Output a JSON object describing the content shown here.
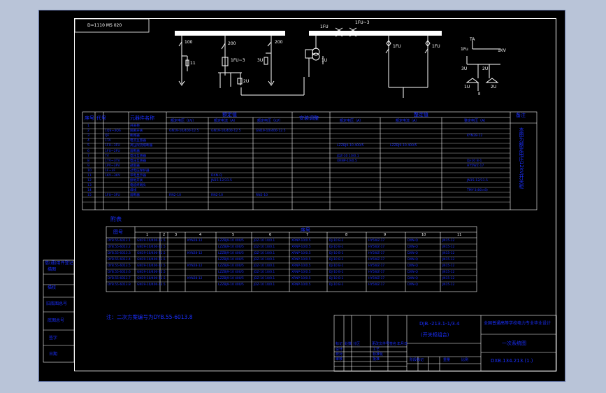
{
  "colors": {
    "paper": "#000000",
    "background": "#b9c4d8",
    "line": "#ffffff",
    "text_blue": "#1a2fff"
  },
  "drawing": {
    "top_code": "D=1110 MS 020",
    "note": "注：二次方案编号为DYB.55-6013.8"
  },
  "schematic": {
    "labels": [
      "100",
      "200",
      "1FU~3",
      "11",
      "3U",
      "200",
      "1U",
      "1FU",
      "1FU~3",
      "2U",
      "1FU",
      "1FU",
      "1Fu",
      "TA",
      "1KV",
      "3U",
      "2U",
      "1U",
      "2U",
      "II"
    ]
  },
  "main_table": {
    "headers": [
      "序号",
      "代号",
      "元器件名称",
      "额定值",
      "安装调整",
      "整定值",
      "备注"
    ],
    "sub_headers": [
      "额定电压（kV）",
      "额定电流（A）",
      "额定电压（kV）",
      "额定电压（A）",
      "额定电流（A）",
      "整定电压（A）"
    ],
    "rows": [
      {
        "no": "1",
        "code": "",
        "name": "开关柜",
        "v1": "",
        "v2": "",
        "v3": "",
        "a": "",
        "s1": "",
        "s2": "",
        "s3": ""
      },
      {
        "no": "2",
        "code": "1QS~3QS",
        "name": "隔离开关",
        "v1": "GN19-10/400-12.5",
        "v2": "GN19-10/400-12.5",
        "v3": "GN19-10/400-12.5",
        "a": "",
        "s1": "",
        "s2": "",
        "s3": ""
      },
      {
        "no": "3",
        "code": "QF",
        "name": "断路器",
        "v1": "",
        "v2": "",
        "v3": "",
        "a": "",
        "s1": "",
        "s2": "",
        "s3": "KYN28-12"
      },
      {
        "no": "4",
        "code": "1TA",
        "name": "电流互感器",
        "v1": "",
        "v2": "",
        "v3": "",
        "a": "",
        "s1": "",
        "s2": "",
        "s3": ""
      },
      {
        "no": "5",
        "code": "1FU~3FU",
        "name": "高压限流熔断器",
        "v1": "",
        "v2": "",
        "v3": "",
        "a": "",
        "s1": "LZZBJ9-10 400/5",
        "s2": "LZZBJ9-10 400/5",
        "s3": ""
      },
      {
        "no": "6",
        "code": "1FU~2FU",
        "name": "熔断器",
        "v1": "",
        "v2": "",
        "v3": "",
        "a": "",
        "s1": "",
        "s2": "",
        "s3": ""
      },
      {
        "no": "7",
        "code": "TV",
        "name": "电压互感器",
        "v1": "",
        "v2": "",
        "v3": "",
        "a": "",
        "s1": "JDZ-10 10/0.1",
        "s2": "",
        "s3": ""
      },
      {
        "no": "8",
        "code": "1TV~3TV",
        "name": "电压互感器",
        "v1": "",
        "v2": "",
        "v3": "",
        "a": "",
        "s1": "XRNP-10/0.5",
        "s2": "",
        "s3": "DJ-10 B-1"
      },
      {
        "no": "9",
        "code": "1PV~3PV",
        "name": "避雷器",
        "v1": "",
        "v2": "",
        "v3": "",
        "a": "",
        "s1": "",
        "s2": "",
        "s3": "HY5WZ-17"
      },
      {
        "no": "10",
        "code": "1F~3F",
        "name": "过电压保护器",
        "v1": "",
        "v2": "",
        "v3": "",
        "a": "",
        "s1": "",
        "s2": "",
        "s3": ""
      },
      {
        "no": "11",
        "code": "1KV~3KV",
        "name": "带电显示器",
        "v1": "",
        "v2": "DXN-Q",
        "v3": "",
        "a": "",
        "s1": "",
        "s2": "",
        "s3": ""
      },
      {
        "no": "12",
        "code": "",
        "name": "接地开关",
        "v1": "",
        "v2": "JN15-12/31.5",
        "v3": "",
        "a": "",
        "s1": "",
        "s2": "",
        "s3": "JN15-12/31.5"
      },
      {
        "no": "13",
        "code": "",
        "name": "电缆终端头",
        "v1": "",
        "v2": "",
        "v3": "",
        "a": "",
        "s1": "",
        "s2": "",
        "s3": ""
      },
      {
        "no": "14",
        "code": "",
        "name": "母线",
        "v1": "",
        "v2": "",
        "v3": "",
        "a": "",
        "s1": "",
        "s2": "",
        "s3": "TMY-3(80×8)"
      },
      {
        "no": "15",
        "code": "1FU~3FU",
        "name": "熔断器",
        "v1": "RN2-10",
        "v2": "RN2-10",
        "v3": "RN2-10",
        "a": "",
        "s1": "",
        "s2": "",
        "s3": ""
      }
    ],
    "remark": "本图为额定电压12kV开关柜"
  },
  "appendix": {
    "title": "附表",
    "headers": [
      "图号",
      "序号"
    ],
    "col_numbers": [
      "1",
      "2",
      "3",
      "4",
      "5",
      "6",
      "7",
      "8",
      "9",
      "10",
      "11"
    ],
    "rows": [
      [
        "DYB.55-6013.1",
        "GN19-10/400-12.5",
        "",
        "KYN28-12",
        "LZZBJ9-10 400/5",
        "JDZ-10 10/0.1",
        "XRNP-10/0.5",
        "DJ-10 B-1",
        "HY5WZ-17",
        "DXN-Q",
        "JN15-12"
      ],
      [
        "DYB.55-6013.2",
        "GN19-10/400-12.5",
        "",
        "",
        "LZZBJ9-10 400/5",
        "JDZ-10 10/0.1",
        "XRNP-10/0.5",
        "DJ-10 B-1",
        "HY5WZ-17",
        "DXN-Q",
        "JN15-12"
      ],
      [
        "DYB.55-6013.3",
        "GN19-10/400-12.5",
        "",
        "KYN28-12",
        "LZZBJ9-10 400/5",
        "JDZ-10 10/0.1",
        "XRNP-10/0.5",
        "DJ-10 B-1",
        "HY5WZ-17",
        "DXN-Q",
        "JN15-12"
      ],
      [
        "DYB.55-6013.4",
        "GN19-10/400-12.5",
        "",
        "",
        "LZZBJ9-10 400/5",
        "JDZ-10 10/0.1",
        "XRNP-10/0.5",
        "DJ-10 B-1",
        "HY5WZ-17",
        "DXN-Q",
        "JN15-12"
      ],
      [
        "DYB.55-6013.5",
        "GN19-10/400-12.5",
        "",
        "KYN28-12",
        "LZZBJ9-10 400/5",
        "JDZ-10 10/0.1",
        "XRNP-10/0.5",
        "DJ-10 B-1",
        "HY5WZ-17",
        "DXN-Q",
        "JN15-12"
      ],
      [
        "DYB.55-6013.6",
        "GN19-10/400-12.5",
        "",
        "",
        "LZZBJ9-10 400/5",
        "JDZ-10 10/0.1",
        "XRNP-10/0.5",
        "DJ-10 B-1",
        "HY5WZ-17",
        "DXN-Q",
        "JN15-12"
      ],
      [
        "DYB.55-6013.7",
        "GN19-10/400-12.5",
        "",
        "KYN28-12",
        "LZZBJ9-10 400/5",
        "JDZ-10 10/0.1",
        "XRNP-10/0.5",
        "DJ-10 B-1",
        "HY5WZ-17",
        "DXN-Q",
        "JN15-12"
      ],
      [
        "DYB.55-6013.8",
        "GN19-10/400-12.5",
        "",
        "",
        "LZZBJ9-10 400/5",
        "JDZ-10 10/0.1",
        "XRNP-10/0.5",
        "DJ-10 B-1",
        "HY5WZ-17",
        "DXN-Q",
        "JN15-12"
      ]
    ]
  },
  "left_stamp": {
    "items": [
      "借(通)用件登记",
      "描图",
      "描校",
      "旧底图总号",
      "底图总号",
      "签字",
      "日期"
    ]
  },
  "title_block": {
    "code_line1": "DJB.-213.1-1/3.4",
    "code_line2": "(开关柜组合)",
    "project": "全国普通高等学校电力专业毕业设计",
    "drawing_name": "一次系统图",
    "drawing_no": "DXB.134.213.(1.)",
    "marks": [
      "标记",
      "处数",
      "分区",
      "更改文件号",
      "签名",
      "年月日"
    ],
    "roles": [
      "设计",
      "校对",
      "审核",
      "工艺",
      "标准化",
      "批准"
    ],
    "phase_labels": [
      "阶段标记",
      "重量",
      "比例"
    ]
  }
}
